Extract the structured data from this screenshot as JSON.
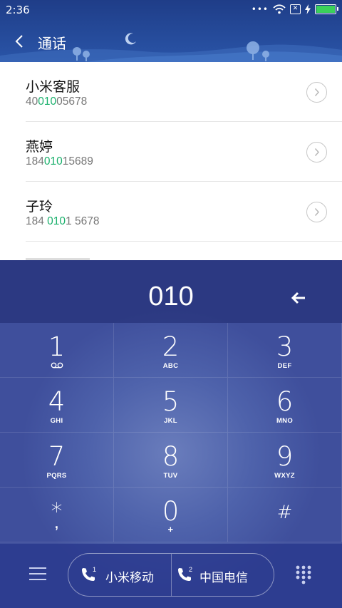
{
  "status_bar": {
    "time": "2:36",
    "dots": "•••",
    "battery_level": 1.0,
    "battery_color": "#3ad15a"
  },
  "header": {
    "title": "通话"
  },
  "contacts": [
    {
      "name": "小米客服",
      "number_pre": "40",
      "number_match": "010",
      "number_post": "05678"
    },
    {
      "name": "燕婷",
      "number_pre": "184",
      "number_match": "010",
      "number_post": "15689"
    },
    {
      "name": "子玲",
      "number_pre": "184 ",
      "number_match": "010",
      "number_post": "1 5678"
    }
  ],
  "dialer": {
    "entered_number": "010",
    "keys": [
      {
        "digit": "1",
        "letters": ""
      },
      {
        "digit": "2",
        "letters": "ABC"
      },
      {
        "digit": "3",
        "letters": "DEF"
      },
      {
        "digit": "4",
        "letters": "GHI"
      },
      {
        "digit": "5",
        "letters": "JKL"
      },
      {
        "digit": "6",
        "letters": "MNO"
      },
      {
        "digit": "7",
        "letters": "PQRS"
      },
      {
        "digit": "8",
        "letters": "TUV"
      },
      {
        "digit": "9",
        "letters": "WXYZ"
      },
      {
        "digit": "*",
        "letters": ","
      },
      {
        "digit": "0",
        "letters": "+"
      },
      {
        "digit": "#",
        "letters": ""
      }
    ],
    "sim1": {
      "slot": "1",
      "label": "小米移动"
    },
    "sim2": {
      "slot": "2",
      "label": "中国电信"
    }
  },
  "colors": {
    "match_highlight": "#1ab06c",
    "header_bg": "#1f3d88",
    "dialer_bg": "#4e62ab"
  },
  "icons": [
    "back-arrow-icon",
    "moon-icon",
    "chevron-right-icon",
    "backspace-icon",
    "voicemail-icon",
    "menu-icon",
    "phone-icon",
    "dialpad-icon",
    "wifi-icon",
    "sim-icon",
    "charging-icon",
    "battery-icon"
  ]
}
